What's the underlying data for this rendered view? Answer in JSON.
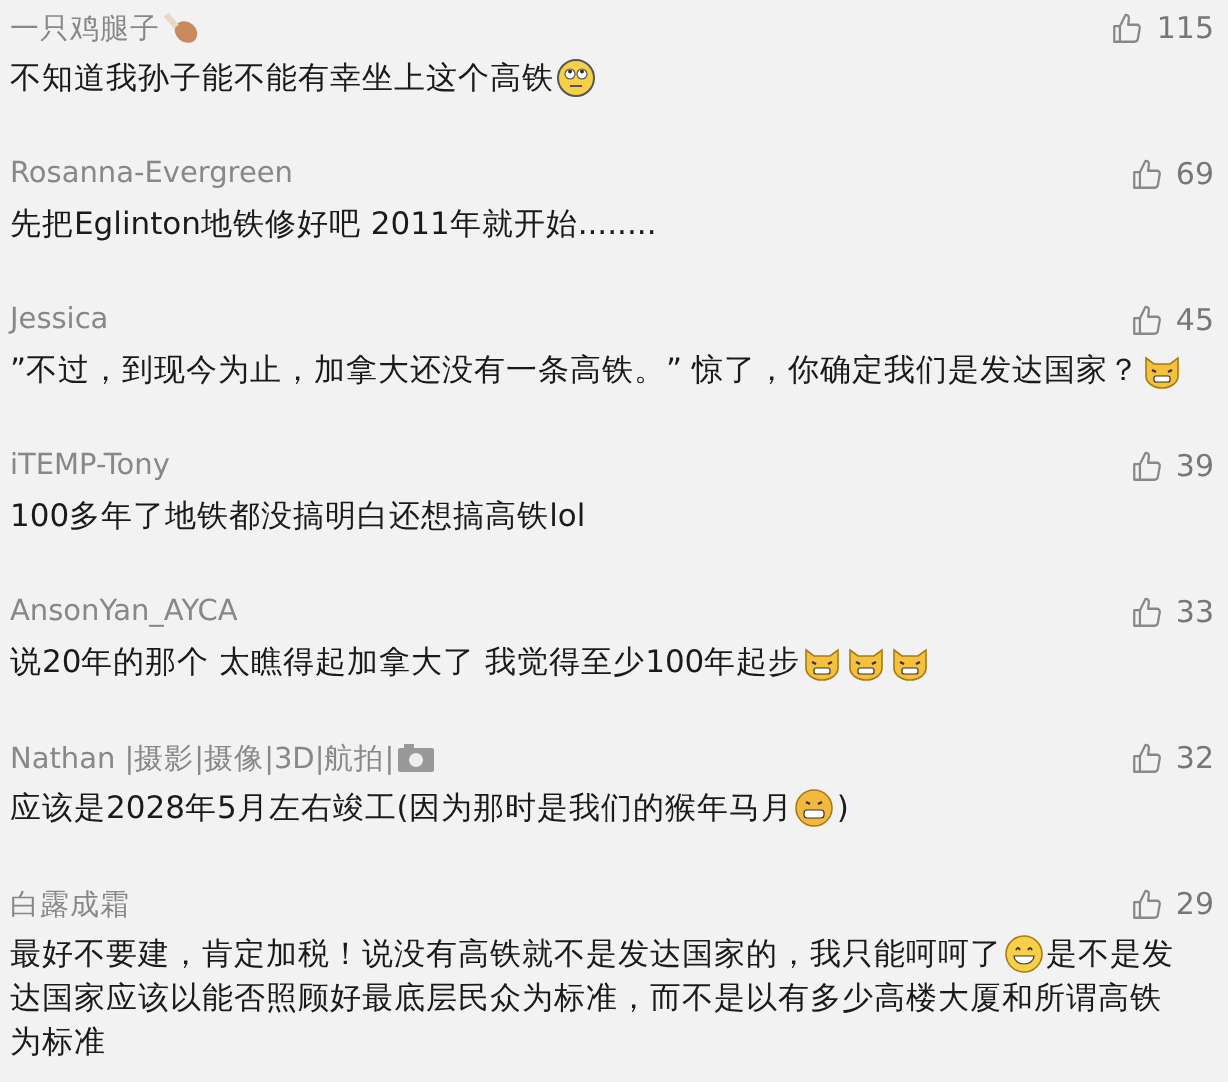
{
  "comments": [
    {
      "author": [
        {
          "kind": "text",
          "text": "一只鸡腿子"
        },
        {
          "kind": "drumstick"
        }
      ],
      "likes": "115",
      "lines": [
        [
          {
            "kind": "text",
            "text": "不知道我孙子能不能有幸坐上这个高铁"
          },
          {
            "kind": "eyeroll"
          }
        ]
      ]
    },
    {
      "author": [
        {
          "kind": "text",
          "text": "Rosanna-Evergreen"
        }
      ],
      "likes": "69",
      "lines": [
        [
          {
            "kind": "text",
            "text": "先把Eglinton地铁修好吧 2011年就开始........"
          }
        ]
      ]
    },
    {
      "author": [
        {
          "kind": "text",
          "text": "Jessica"
        }
      ],
      "likes": "45",
      "lines": [
        [
          {
            "kind": "text",
            "text": "”不过，到现今为止，加拿大还没有一条高铁。” 惊了，你确定我们是发达国家？"
          },
          {
            "kind": "cat"
          }
        ]
      ]
    },
    {
      "author": [
        {
          "kind": "text",
          "text": "iTEMP-Tony"
        }
      ],
      "likes": "39",
      "lines": [
        [
          {
            "kind": "text",
            "text": "100多年了地铁都没搞明白还想搞高铁lol"
          }
        ]
      ]
    },
    {
      "author": [
        {
          "kind": "text",
          "text": "AnsonYan_AYCA"
        }
      ],
      "likes": "33",
      "lines": [
        [
          {
            "kind": "text",
            "text": "说20年的那个 太瞧得起加拿大了 我觉得至少100年起步"
          },
          {
            "kind": "cat"
          },
          {
            "kind": "cat"
          },
          {
            "kind": "cat"
          }
        ]
      ]
    },
    {
      "author": [
        {
          "kind": "text",
          "text": "Nathan |摄影|摄像|3D|航拍|"
        },
        {
          "kind": "camera"
        }
      ],
      "likes": "32",
      "lines": [
        [
          {
            "kind": "text",
            "text": "应该是2028年5月左右竣工(因为那时是我们的猴年马月"
          },
          {
            "kind": "grimace"
          },
          {
            "kind": "text",
            "text": ")"
          }
        ]
      ]
    },
    {
      "author": [
        {
          "kind": "text",
          "text": "白露成霜"
        }
      ],
      "likes": "29",
      "lines": [
        [
          {
            "kind": "text",
            "text": "最好不要建，肯定加税！说没有高铁就不是发达国家的，我只能呵呵了"
          },
          {
            "kind": "smile"
          },
          {
            "kind": "text",
            "text": "是不是发"
          }
        ],
        [
          {
            "kind": "text",
            "text": "达国家应该以能否照顾好最底层民众为标准，而不是以有多少高楼大厦和所谓高铁"
          }
        ],
        [
          {
            "kind": "text",
            "text": "为标准"
          }
        ]
      ]
    }
  ]
}
